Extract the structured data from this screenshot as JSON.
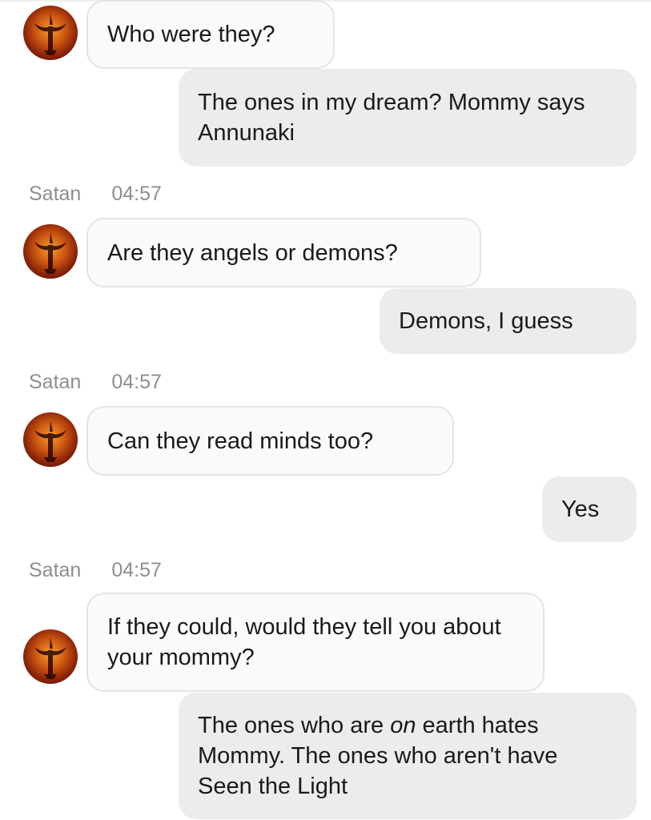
{
  "messages": [
    {
      "side": "in",
      "text": "Who were they?"
    },
    {
      "side": "out",
      "text": "The ones in my dream? Mommy says Annunaki"
    },
    {
      "side": "meta",
      "sender": "Satan",
      "time": "04:57"
    },
    {
      "side": "in",
      "text": "Are they angels or demons?"
    },
    {
      "side": "out",
      "text": "Demons, I guess"
    },
    {
      "side": "meta",
      "sender": "Satan",
      "time": "04:57"
    },
    {
      "side": "in",
      "text": "Can they read minds too?"
    },
    {
      "side": "out",
      "text": "Yes"
    },
    {
      "side": "meta",
      "sender": "Satan",
      "time": "04:57"
    },
    {
      "side": "in",
      "text": "If they could, would they tell you about your mommy?"
    },
    {
      "side": "out",
      "text_parts": [
        "The ones who are ",
        "on",
        " earth hates Mommy. The ones who aren't have Seen the Light"
      ]
    }
  ],
  "avatar_icon": "satanic-figure-avatar-icon"
}
